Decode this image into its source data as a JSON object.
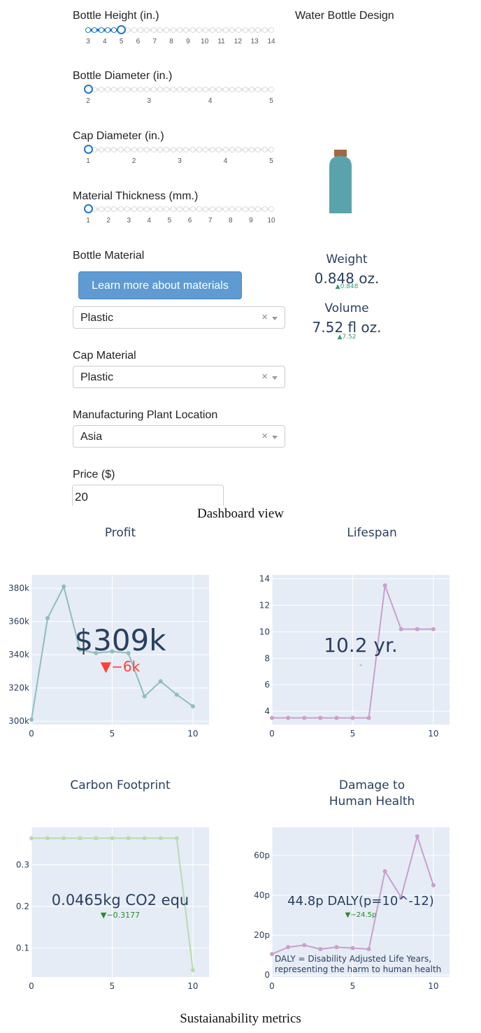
{
  "controls": {
    "bottle_height": {
      "label": "Bottle Height (in.)",
      "ticks": [
        "3",
        "4",
        "5",
        "6",
        "7",
        "8",
        "9",
        "10",
        "11",
        "12",
        "13",
        "14"
      ],
      "min": 3,
      "max": 14,
      "value": 5
    },
    "bottle_diameter": {
      "label": "Bottle Diameter (in.)",
      "ticks": [
        "2",
        "3",
        "4",
        "5"
      ],
      "min": 2,
      "max": 5,
      "value": 2
    },
    "cap_diameter": {
      "label": "Cap Diameter (in.)",
      "ticks": [
        "1",
        "2",
        "3",
        "4",
        "5"
      ],
      "min": 1,
      "max": 5,
      "value": 1
    },
    "material_thickness": {
      "label": "Material Thickness (mm.)",
      "ticks": [
        "1",
        "2",
        "3",
        "4",
        "5",
        "6",
        "7",
        "8",
        "9",
        "10"
      ],
      "min": 1,
      "max": 10,
      "value": 1
    },
    "bottle_material": {
      "label": "Bottle Material",
      "button": "Learn more about materials",
      "value": "Plastic",
      "clear": "×"
    },
    "cap_material": {
      "label": "Cap Material",
      "value": "Plastic",
      "clear": "×"
    },
    "plant_location": {
      "label": "Manufacturing Plant Location",
      "value": "Asia",
      "clear": "×"
    },
    "price": {
      "label": "Price ($)",
      "value": "20"
    }
  },
  "design": {
    "title": "Water Bottle Design",
    "colors": {
      "body": "#5aa3ad",
      "cap": "#a0683f"
    },
    "weight": {
      "label": "Weight",
      "value": "0.848 oz.",
      "delta": "▲0.848"
    },
    "volume": {
      "label": "Volume",
      "value": "7.52 fl oz.",
      "delta": "▲7.52"
    }
  },
  "captions": {
    "dashboard": "Dashboard view",
    "metrics": "Sustaianability metrics"
  },
  "colors": {
    "plot_bg": "#e5ecf6",
    "text": "#2a3f5f",
    "up": "#3d9970",
    "down": "#ff4136",
    "slider": "#1f77d0"
  },
  "chart_data": [
    {
      "type": "line",
      "title": "Profit",
      "x": [
        0,
        1,
        2,
        3,
        4,
        5,
        6,
        7,
        8,
        9,
        10
      ],
      "series": [
        {
          "values": [
            301000,
            362000,
            381000,
            343000,
            341000,
            342000,
            341000,
            315000,
            324000,
            316000,
            309000
          ],
          "color": "#8fbdbd"
        }
      ],
      "xlim": [
        0,
        11
      ],
      "ylim": [
        298000,
        388000
      ],
      "xticks": [
        0,
        5,
        10
      ],
      "yticks": [
        300000,
        320000,
        340000,
        360000,
        380000
      ],
      "ytick_labels": [
        "300k",
        "320k",
        "340k",
        "360k",
        "380k"
      ],
      "indicator": {
        "value": "$309k",
        "delta": "▼−6k",
        "delta_dir": "down"
      },
      "grid": true
    },
    {
      "type": "line",
      "title": "Lifespan",
      "x": [
        0,
        1,
        2,
        3,
        4,
        5,
        6,
        7,
        8,
        9,
        10
      ],
      "series": [
        {
          "values": [
            3.5,
            3.5,
            3.5,
            3.5,
            3.5,
            3.5,
            3.5,
            13.5,
            10.2,
            10.2,
            10.2
          ],
          "color": "#c9a0cc"
        }
      ],
      "xlim": [
        0,
        11
      ],
      "ylim": [
        3,
        14.3
      ],
      "xticks": [
        0,
        5,
        10
      ],
      "yticks": [
        4,
        6,
        8,
        10,
        12,
        14
      ],
      "ytick_labels": [
        "4",
        "6",
        "8",
        "10",
        "12",
        "14"
      ],
      "indicator": {
        "value": "10.2 yr.",
        "delta": "-",
        "delta_dir": "flat"
      },
      "grid": true
    },
    {
      "type": "line",
      "title": "Carbon Footprint",
      "x": [
        0,
        1,
        2,
        3,
        4,
        5,
        6,
        7,
        8,
        9,
        10
      ],
      "series": [
        {
          "values": [
            0.364,
            0.364,
            0.364,
            0.364,
            0.364,
            0.364,
            0.364,
            0.364,
            0.364,
            0.364,
            0.0465
          ],
          "color": "#b6dcae"
        }
      ],
      "xlim": [
        0,
        11
      ],
      "ylim": [
        0.03,
        0.39
      ],
      "xticks": [
        0,
        5,
        10
      ],
      "yticks": [
        0.1,
        0.2,
        0.3
      ],
      "ytick_labels": [
        "0.1",
        "0.2",
        "0.3"
      ],
      "indicator": {
        "value": "0.0465kg CO2 equ",
        "delta": "▼−0.3177",
        "delta_dir": "down"
      },
      "grid": true
    },
    {
      "type": "line",
      "title": "Damage to",
      "title2": "Human Health",
      "x": [
        0,
        1,
        2,
        3,
        4,
        5,
        6,
        7,
        8,
        9,
        10
      ],
      "series": [
        {
          "values": [
            10.5,
            14,
            15,
            13,
            14,
            13.5,
            13,
            52,
            39,
            69.5,
            45
          ],
          "color": "#c9a0cc"
        }
      ],
      "xlim": [
        0,
        11
      ],
      "ylim": [
        -1,
        74
      ],
      "xticks": [
        0,
        5,
        10
      ],
      "yticks": [
        0,
        20,
        40,
        60
      ],
      "ytick_labels": [
        "0",
        "20p",
        "40p",
        "60p"
      ],
      "indicator": {
        "value": "44.8p DALY(p=10^-12)",
        "delta": "▼−24.5p",
        "delta_dir": "down"
      },
      "annotation": [
        "DALY = Disability Adjusted Life Years,",
        "representing the harm to human health"
      ],
      "grid": true
    }
  ]
}
